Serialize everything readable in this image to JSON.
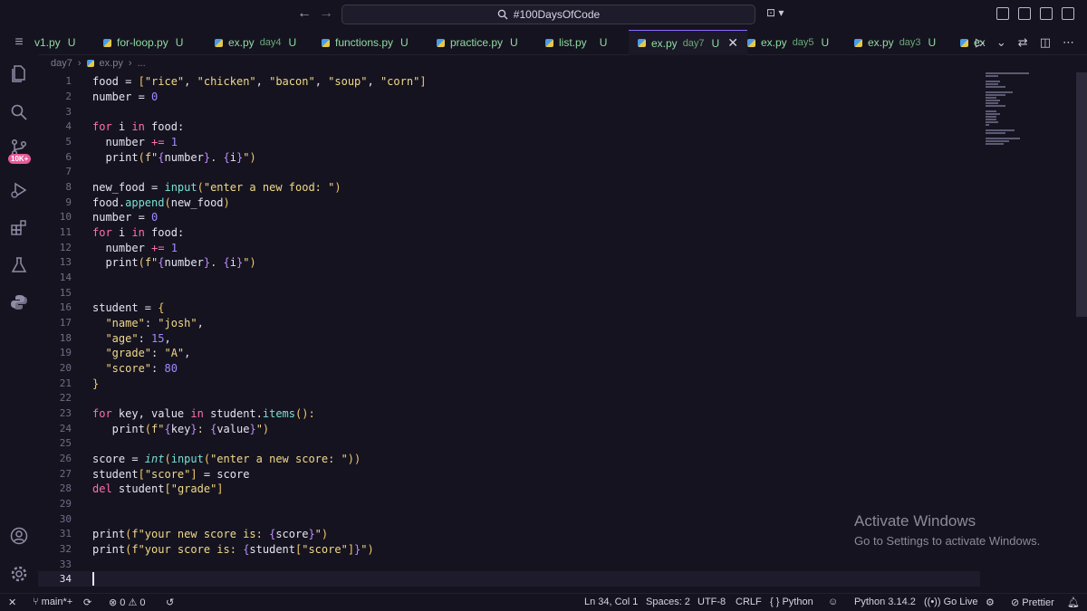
{
  "titlebar": {
    "search_text": "#100DaysOfCode",
    "back_icon": "arrow-left-icon",
    "forward_icon": "arrow-right-icon"
  },
  "activity_bar": {
    "badge": "10K+"
  },
  "tabs": [
    {
      "label": "v1.py",
      "status": "U"
    },
    {
      "label": "for-loop.py",
      "status": "U"
    },
    {
      "label": "ex.py",
      "dir": "day4",
      "status": "U"
    },
    {
      "label": "functions.py",
      "status": "U"
    },
    {
      "label": "practice.py",
      "status": "U"
    },
    {
      "label": "list.py",
      "status": "U"
    },
    {
      "label": "ex.py",
      "dir": "day7",
      "status": "U",
      "active": true
    },
    {
      "label": "ex.py",
      "dir": "day5",
      "status": "U"
    },
    {
      "label": "ex.py",
      "dir": "day3",
      "status": "U"
    },
    {
      "label": "ex"
    }
  ],
  "breadcrumb": {
    "folder": "day7",
    "file": "ex.py",
    "tail": "..."
  },
  "code_lines": [
    "1",
    "2",
    "3",
    "4",
    "5",
    "6",
    "7",
    "8",
    "9",
    "10",
    "11",
    "12",
    "13",
    "14",
    "15",
    "16",
    "17",
    "18",
    "19",
    "20",
    "21",
    "22",
    "23",
    "24",
    "25",
    "26",
    "27",
    "28",
    "29",
    "30",
    "31",
    "32",
    "33",
    "34"
  ],
  "code_text": {
    "l1a": "food = ",
    "l1b": "[",
    "l1c": "\"rice\"",
    "l1d": ", ",
    "l1e": "\"chicken\"",
    "l1f": ", ",
    "l1g": "\"bacon\"",
    "l1h": ", ",
    "l1i": "\"soup\"",
    "l1j": ", ",
    "l1k": "\"corn\"",
    "l1l": "]",
    "l2a": "number = ",
    "l2b": "0",
    "l4a": "for",
    "l4b": " i ",
    "l4c": "in",
    "l4d": " food:",
    "l5a": "  number ",
    "l5b": "+=",
    "l5c": " ",
    "l5d": "1",
    "l6a": "  print",
    "l6b": "(",
    "l6c": "f\"",
    "l6d": "{",
    "l6e": "number",
    "l6f": "}",
    "l6g": ". ",
    "l6h": "{",
    "l6i": "i",
    "l6j": "}",
    "l6k": "\"",
    "l6l": ")",
    "l8a": "new_food = ",
    "l8b": "input",
    "l8c": "(",
    "l8d": "\"enter a new food: \"",
    "l8e": ")",
    "l9a": "food.",
    "l9b": "append",
    "l9c": "(",
    "l9d": "new_food",
    "l9e": ")",
    "l10a": "number = ",
    "l10b": "0",
    "l11a": "for",
    "l11b": " i ",
    "l11c": "in",
    "l11d": " food:",
    "l12a": "  number ",
    "l12b": "+=",
    "l12c": " ",
    "l12d": "1",
    "l13a": "  print",
    "l13b": "(",
    "l13c": "f\"",
    "l13d": "{",
    "l13e": "number",
    "l13f": "}",
    "l13g": ". ",
    "l13h": "{",
    "l13i": "i",
    "l13j": "}",
    "l13k": "\"",
    "l13l": ")",
    "l16a": "student = ",
    "l16b": "{",
    "l17a": "  ",
    "l17b": "\"name\"",
    "l17c": ": ",
    "l17d": "\"josh\"",
    "l17e": ",",
    "l18a": "  ",
    "l18b": "\"age\"",
    "l18c": ": ",
    "l18d": "15",
    "l18e": ",",
    "l19a": "  ",
    "l19b": "\"grade\"",
    "l19c": ": ",
    "l19d": "\"A\"",
    "l19e": ",",
    "l20a": "  ",
    "l20b": "\"score\"",
    "l20c": ": ",
    "l20d": "80",
    "l21a": "}",
    "l23a": "for",
    "l23b": " key, value ",
    "l23c": "in",
    "l23d": " student.",
    "l23e": "items",
    "l23f": "():",
    "l24a": "   print",
    "l24b": "(",
    "l24c": "f\"",
    "l24d": "{",
    "l24e": "key",
    "l24f": "}",
    "l24g": ": ",
    "l24h": "{",
    "l24i": "value",
    "l24j": "}",
    "l24k": "\"",
    "l24l": ")",
    "l26a": "score = ",
    "l26b": "int",
    "l26c": "(",
    "l26d": "input",
    "l26e": "(",
    "l26f": "\"enter a new score: \"",
    "l26g": "))",
    "l27a": "student",
    "l27b": "[",
    "l27c": "\"score\"",
    "l27d": "]",
    "l27e": " = score",
    "l28a": "del",
    "l28b": " student",
    "l28c": "[",
    "l28d": "\"grade\"",
    "l28e": "]",
    "l31a": "print",
    "l31b": "(",
    "l31c": "f\"your new score is: ",
    "l31d": "{",
    "l31e": "score",
    "l31f": "}",
    "l31g": "\"",
    "l31h": ")",
    "l32a": "print",
    "l32b": "(",
    "l32c": "f\"your score is: ",
    "l32d": "{",
    "l32e": "student",
    "l32f": "[",
    "l32g": "\"score\"",
    "l32h": "]",
    "l32i": "}",
    "l32j": "\"",
    "l32k": ")"
  },
  "watermark": {
    "title": "Activate Windows",
    "subtitle": "Go to Settings to activate Windows."
  },
  "statusbar": {
    "branch": "main*+",
    "errors": "0",
    "warnings": "0",
    "position": "Ln 34, Col 1",
    "spaces": "Spaces: 2",
    "encoding": "UTF-8",
    "eol": "CRLF",
    "language": "Python",
    "interpreter": "Python 3.14.2",
    "golive": "Go Live",
    "prettier": "Prettier"
  },
  "colors": {
    "background": "#15131f",
    "tab_text": "#8fdca0",
    "keyword": "#ff6fb0",
    "string": "#f0d98a",
    "number": "#9f8cff",
    "function": "#78e2d6",
    "badge": "#e85a9a"
  }
}
